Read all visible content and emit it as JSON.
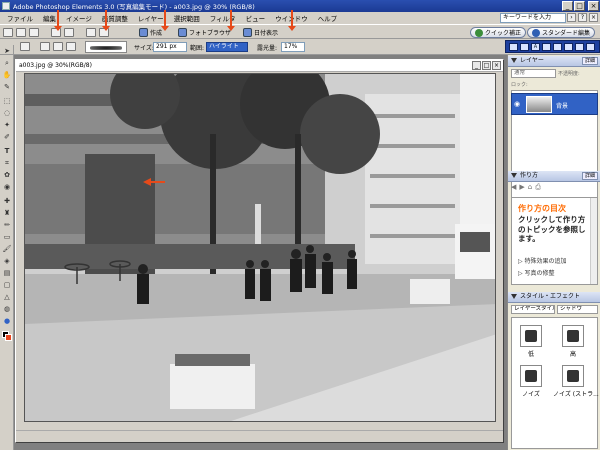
{
  "window": {
    "title": "Adobe Photoshop Elements 3.0 (写真編集モード) - a003.jpg @ 30% (RGB/8)"
  },
  "menubar": {
    "items": [
      "ファイル",
      "編集",
      "イメージ",
      "画質調整",
      "レイヤー",
      "選択範囲",
      "フィルタ",
      "ビュー",
      "ウインドウ",
      "ヘルプ"
    ],
    "help_search_placeholder": "キーワードを入力"
  },
  "shortcuts": {
    "create_label": "作成",
    "photo_browser_label": "フォトブラウザ",
    "date_view_label": "日付表示",
    "quick_fix_label": "クイック補正",
    "standard_edit_label": "スタンダード編集"
  },
  "options": {
    "size_label": "サイズ:",
    "size_value": "291 px",
    "range_label": "範囲:",
    "range_value": "ハイライト",
    "exposure_label": "露光量:",
    "exposure_value": "17%"
  },
  "document": {
    "title": "a003.jpg @ 30%(RGB/8)"
  },
  "layers_panel": {
    "title": "レイヤー",
    "more_label": "詳細",
    "blend_mode": "通常",
    "opacity_label": "不透明度:",
    "lock_label": "ロック:",
    "layer_name": "背景"
  },
  "howto_panel": {
    "title": "作り方",
    "more_label": "詳細",
    "heading": "作り方の目次",
    "body": "クリックして作り方のトピックを参照します。",
    "links": [
      "特殊効果の追加",
      "写真の修整"
    ]
  },
  "styles_panel": {
    "title": "スタイル・エフェクト",
    "category": "レイヤースタイル",
    "category2": "シャドウ",
    "styles": [
      "低",
      "高",
      "ノイズ",
      "ノイズ (ストラ..."
    ]
  },
  "accent_colors": {
    "titlebar": "#1b3a93",
    "annotation_arrow": "#e64a1a",
    "selection": "#3162c5",
    "help_heading": "#ff6a00"
  }
}
